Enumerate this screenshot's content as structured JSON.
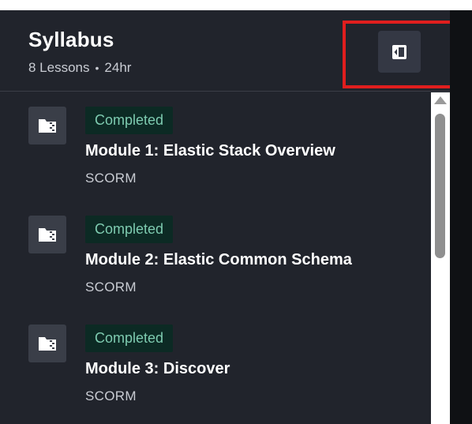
{
  "header": {
    "title": "Syllabus",
    "lessons": "8 Lessons",
    "separator": "•",
    "duration": "24hr"
  },
  "collapse_button": {
    "icon": "sidebar-collapse-icon"
  },
  "items": [
    {
      "status": "Completed",
      "title": "Module 1: Elastic Stack Overview",
      "type": "SCORM",
      "icon": "scorm-package-icon"
    },
    {
      "status": "Completed",
      "title": "Module 2: Elastic Common Schema",
      "type": "SCORM",
      "icon": "scorm-package-icon"
    },
    {
      "status": "Completed",
      "title": "Module 3: Discover",
      "type": "SCORM",
      "icon": "scorm-package-icon"
    }
  ],
  "colors": {
    "panel_bg": "#21242c",
    "badge_bg": "#0c2a24",
    "badge_text": "#7ecbb0",
    "highlight": "#e01e1e"
  }
}
